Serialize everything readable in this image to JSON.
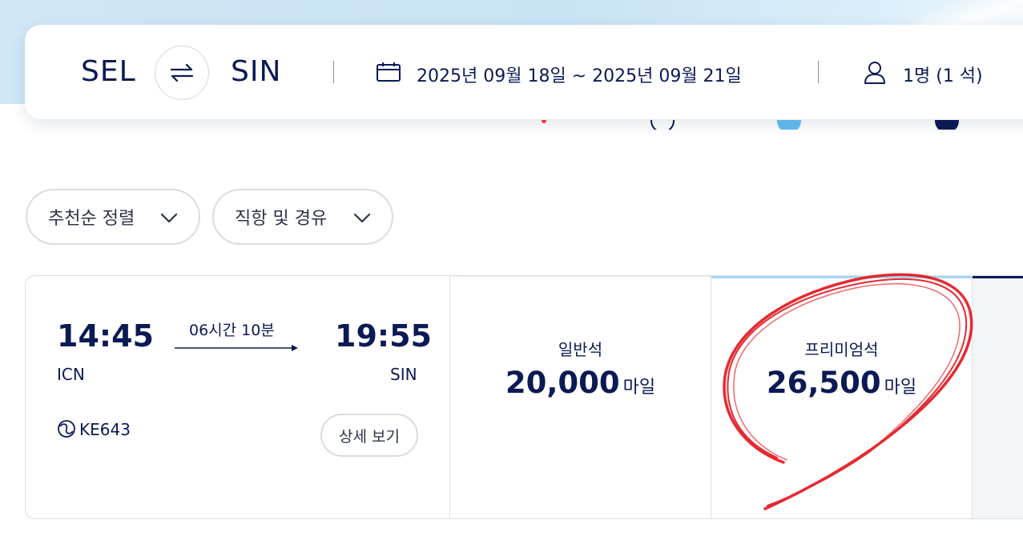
{
  "search": {
    "origin": "SEL",
    "destination": "SIN",
    "date_range": "2025년 09월 18일 ~ 2025년 09월 21일",
    "passengers": "1명 (1 석)"
  },
  "filters": {
    "sort_label": "추천순 정렬",
    "stops_label": "직항 및 경유"
  },
  "flight": {
    "departure_time": "14:45",
    "departure_airport": "ICN",
    "arrival_time": "19:55",
    "arrival_airport": "SIN",
    "duration": "06시간 10분",
    "flight_number": "KE643",
    "detail_label": "상세 보기"
  },
  "fares": [
    {
      "class": "일반석",
      "amount": "20,000",
      "unit": "마일"
    },
    {
      "class": "프리미엄석",
      "amount": "26,500",
      "unit": "마일"
    }
  ],
  "colors": {
    "navy": "#0b1a55",
    "annotation_red": "#e3131b",
    "premium_accent": "#a6d8f0"
  }
}
